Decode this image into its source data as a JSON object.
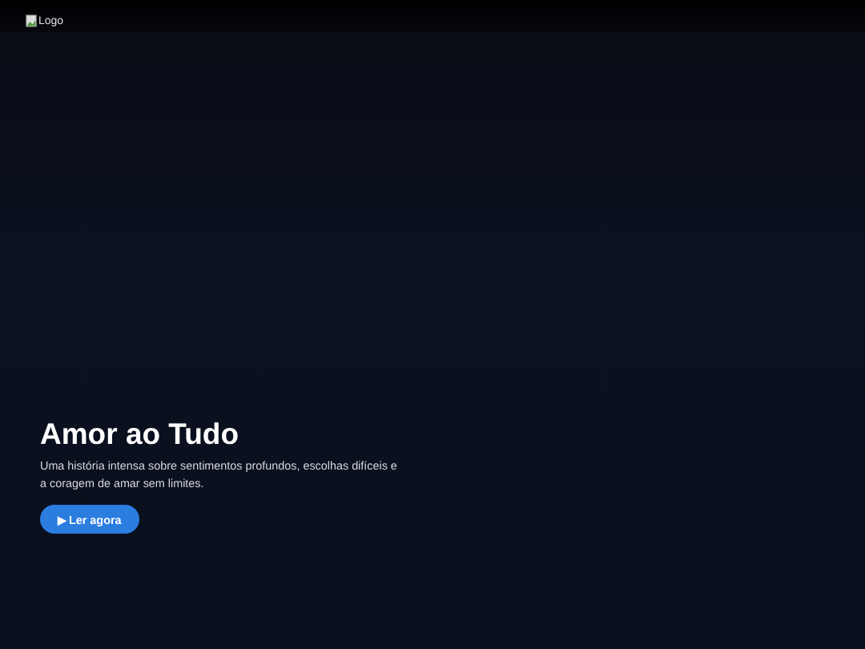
{
  "header": {
    "logo_alt": "Logo"
  },
  "hero": {
    "title": "Amor ao Tudo",
    "description": "Uma história intensa sobre sentimentos profundos, escolhas difíceis e a coragem de amar sem limites.",
    "button": {
      "icon": "▶",
      "label": "Ler agora"
    }
  }
}
